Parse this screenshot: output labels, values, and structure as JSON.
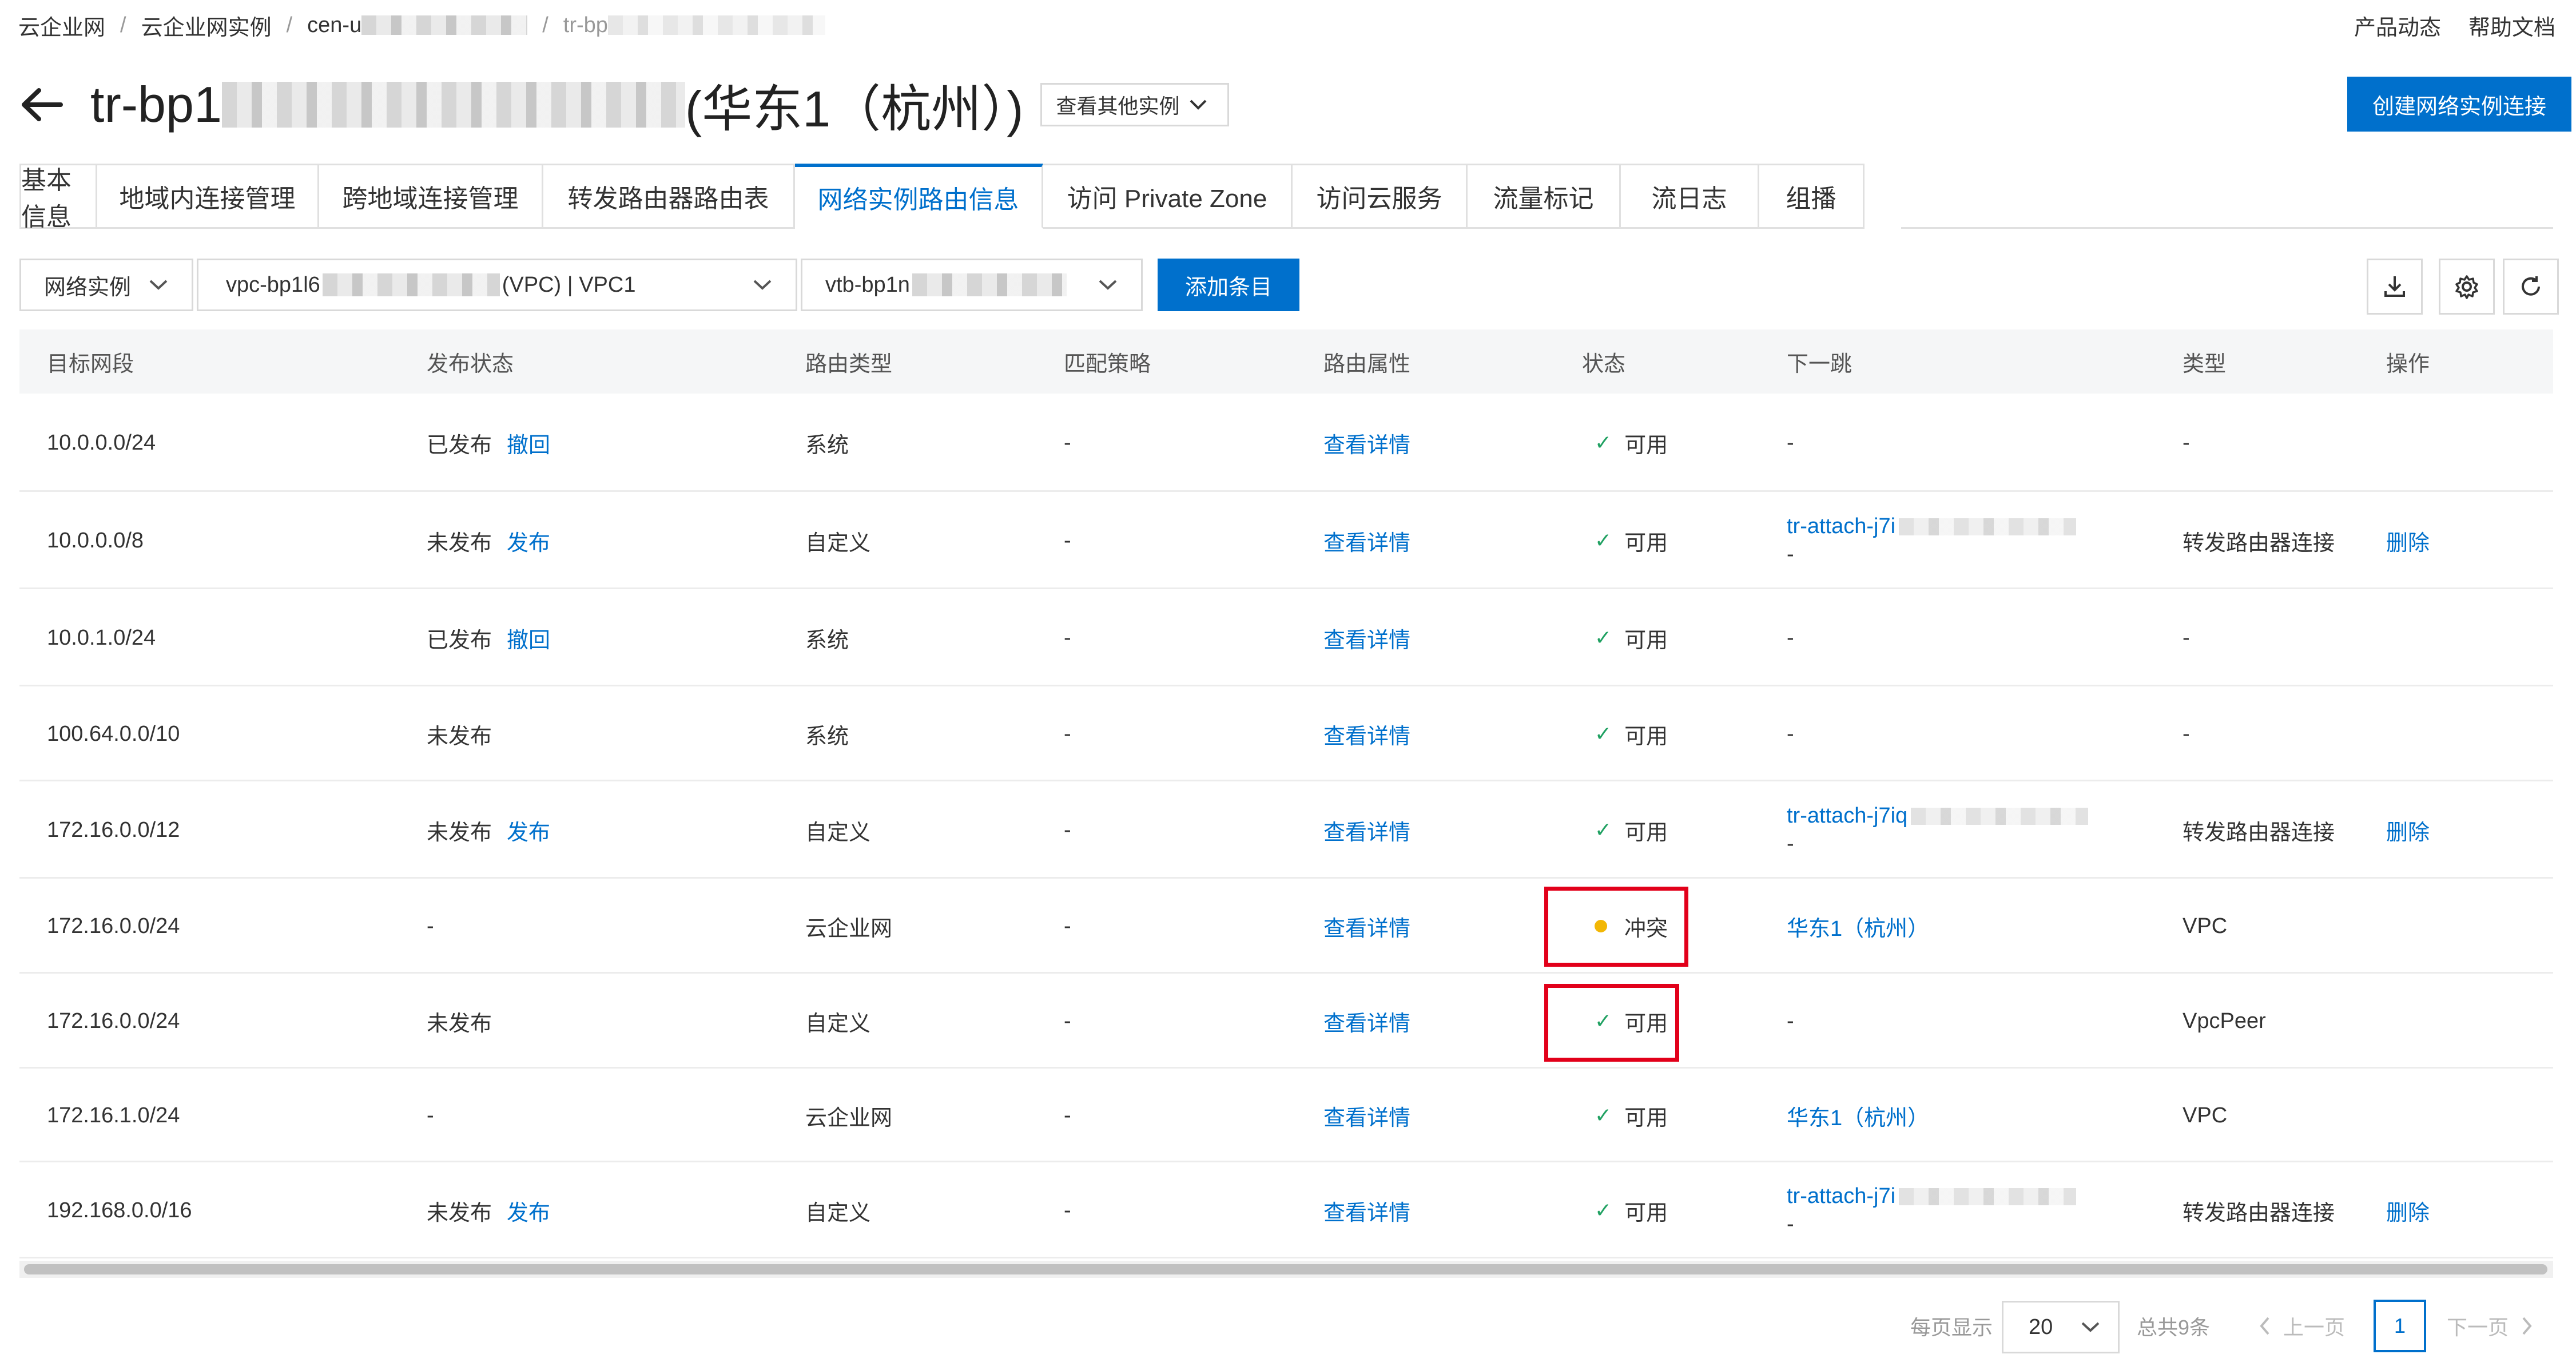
{
  "breadcrumb": {
    "items": [
      "云企业网",
      "云企业网实例",
      "cen-u",
      "tr-bp"
    ],
    "separator": "/"
  },
  "top_links": [
    "产品动态",
    "帮助文档"
  ],
  "title": {
    "prefix": "tr-bp1",
    "suffix": "(华东1（杭州）)",
    "switch_label": "查看其他实例"
  },
  "create_button": "创建网络实例连接",
  "tabs": [
    {
      "label": "基本信息",
      "active": false
    },
    {
      "label": "地域内连接管理",
      "active": false
    },
    {
      "label": "跨地域连接管理",
      "active": false
    },
    {
      "label": "转发路由器路由表",
      "active": false
    },
    {
      "label": "网络实例路由信息",
      "active": true
    },
    {
      "label": "访问 Private Zone",
      "active": false
    },
    {
      "label": "访问云服务",
      "active": false
    },
    {
      "label": "流量标记",
      "active": false
    },
    {
      "label": "流日志",
      "active": false
    },
    {
      "label": "组播",
      "active": false
    }
  ],
  "filters": {
    "instance_type": "网络实例",
    "vpc_prefix": "vpc-bp1l6",
    "vpc_suffix": "(VPC) | VPC1",
    "vtb_prefix": "vtb-bp1n",
    "add_button": "添加条目"
  },
  "table": {
    "columns": [
      "目标网段",
      "发布状态",
      "路由类型",
      "匹配策略",
      "路由属性",
      "状态",
      "下一跳",
      "类型",
      "操作"
    ],
    "rows": [
      {
        "cidr": "10.0.0.0/24",
        "publish": "已发布",
        "publish_action": "撤回",
        "route_type": "系统",
        "policy": "-",
        "attr": "查看详情",
        "status": "可用",
        "status_icon": "check-icon",
        "next_hop": "-",
        "next_hop_sub": "",
        "type": "-",
        "op": ""
      },
      {
        "cidr": "10.0.0.0/8",
        "publish": "未发布",
        "publish_action": "发布",
        "route_type": "自定义",
        "policy": "-",
        "attr": "查看详情",
        "status": "可用",
        "status_icon": "check-icon",
        "next_hop": "tr-attach-j7i",
        "next_hop_sub": "-",
        "type": "转发路由器连接",
        "op": "删除"
      },
      {
        "cidr": "10.0.1.0/24",
        "publish": "已发布",
        "publish_action": "撤回",
        "route_type": "系统",
        "policy": "-",
        "attr": "查看详情",
        "status": "可用",
        "status_icon": "check-icon",
        "next_hop": "-",
        "next_hop_sub": "",
        "type": "-",
        "op": ""
      },
      {
        "cidr": "100.64.0.0/10",
        "publish": "未发布",
        "publish_action": "",
        "route_type": "系统",
        "policy": "-",
        "attr": "查看详情",
        "status": "可用",
        "status_icon": "check-icon",
        "next_hop": "-",
        "next_hop_sub": "",
        "type": "-",
        "op": ""
      },
      {
        "cidr": "172.16.0.0/12",
        "publish": "未发布",
        "publish_action": "发布",
        "route_type": "自定义",
        "policy": "-",
        "attr": "查看详情",
        "status": "可用",
        "status_icon": "check-icon",
        "next_hop": "tr-attach-j7iq",
        "next_hop_sub": "-",
        "type": "转发路由器连接",
        "op": "删除"
      },
      {
        "cidr": "172.16.0.0/24",
        "publish": "-",
        "publish_action": "",
        "route_type": "云企业网",
        "policy": "-",
        "attr": "查看详情",
        "status": "冲突",
        "status_icon": "warning-dot-icon",
        "next_hop": "华东1（杭州）",
        "next_hop_sub": "",
        "type": "VPC",
        "op": ""
      },
      {
        "cidr": "172.16.0.0/24",
        "publish": "未发布",
        "publish_action": "",
        "route_type": "自定义",
        "policy": "-",
        "attr": "查看详情",
        "status": "可用",
        "status_icon": "check-icon",
        "next_hop": "-",
        "next_hop_sub": "",
        "type": "VpcPeer",
        "op": ""
      },
      {
        "cidr": "172.16.1.0/24",
        "publish": "-",
        "publish_action": "",
        "route_type": "云企业网",
        "policy": "-",
        "attr": "查看详情",
        "status": "可用",
        "status_icon": "check-icon",
        "next_hop": "华东1（杭州）",
        "next_hop_sub": "",
        "type": "VPC",
        "op": ""
      },
      {
        "cidr": "192.168.0.0/16",
        "publish": "未发布",
        "publish_action": "发布",
        "route_type": "自定义",
        "policy": "-",
        "attr": "查看详情",
        "status": "可用",
        "status_icon": "check-icon",
        "next_hop": "tr-attach-j7i",
        "next_hop_sub": "-",
        "type": "转发路由器连接",
        "op": "删除"
      }
    ]
  },
  "pagination": {
    "per_page_label": "每页显示",
    "per_page_value": "20",
    "total": "总共9条",
    "prev": "上一页",
    "current": "1",
    "next": "下一页"
  },
  "colors": {
    "primary": "#0070cc",
    "success": "#20a162",
    "warning": "#f2b705",
    "highlight": "#e2001a"
  }
}
